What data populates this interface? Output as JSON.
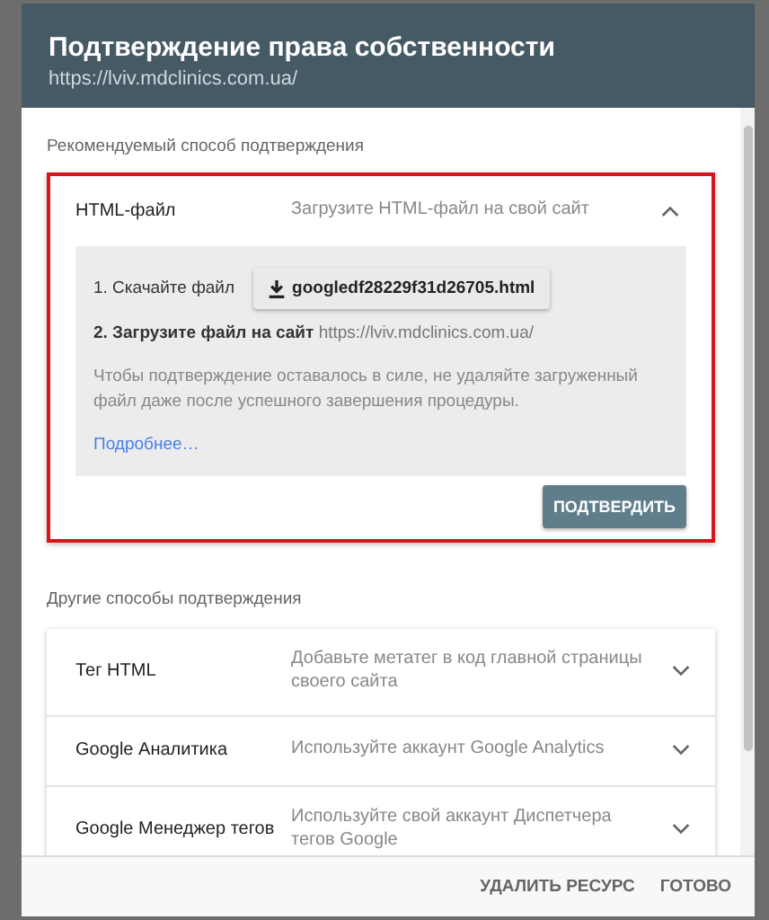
{
  "dialog": {
    "title": "Подтверждение права собственности",
    "subtitle": "https://lviv.mdclinics.com.ua/"
  },
  "recommended": {
    "heading": "Рекомендуемый способ подтверждения",
    "method": {
      "name": "HTML-файл",
      "description": "Загрузите HTML-файл на свой сайт",
      "expanded": true,
      "step1": "1. Скачайте файл",
      "download_button": "googledf28229f31d26705.html",
      "step2": "**2. Загрузите файл на сайт** https://lviv.mdclinics.com.ua/",
      "note": "Чтобы подтверждение оставалось в силе, не удаляйте загруженный файл даже после успешного завершения процедуры.",
      "link": "Подробнее…",
      "confirm_button": "ПОДТВЕРДИТЬ"
    }
  },
  "other": {
    "heading": "Другие способы подтверждения",
    "methods": [
      {
        "name": "Тег HTML",
        "description": "Добавьте метатег в код главной страницы своего сайта",
        "expanded": false
      },
      {
        "name": "Google Аналитика",
        "description": "Используйте аккаунт Google Analytics",
        "expanded": false
      },
      {
        "name": "Google Менеджер тегов",
        "description": "Используйте свой аккаунт Диспетчера тегов Google",
        "expanded": false
      }
    ]
  },
  "footer": {
    "buttons": [
      "УДАЛИТЬ РЕСУРС",
      "ГОТОВО"
    ]
  }
}
